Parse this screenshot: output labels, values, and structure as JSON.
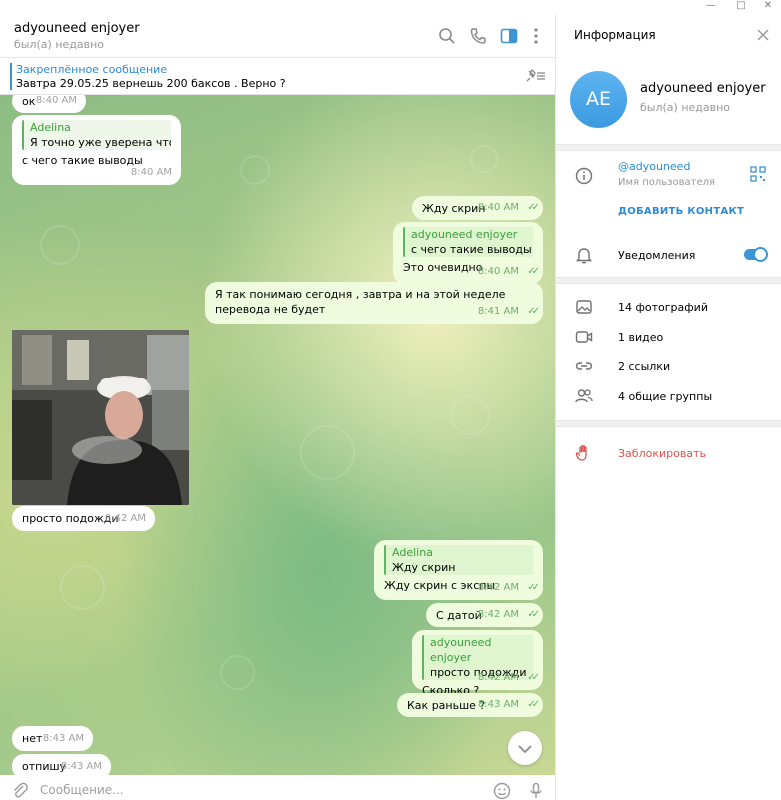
{
  "window": {
    "controls": [
      "minimize",
      "maximize",
      "close"
    ]
  },
  "chat": {
    "header": {
      "name": "adyouneed enjoyer",
      "status": "был(а) недавно"
    },
    "pinned": {
      "title": "Закреплённое сообщение",
      "text": "Завтра 29.05.25 вернешь 200 баксов . Верно ?"
    },
    "messages": [
      {
        "dir": "in",
        "text": "ок",
        "time": "8:40 AM"
      },
      {
        "dir": "in",
        "reply_name": "Adelina",
        "reply_text": "Я точно уже уверена что т...",
        "text": "с чего такие выводы",
        "time": "8:40 AM"
      },
      {
        "dir": "out",
        "text": "Жду скрин",
        "time": "8:40 AM"
      },
      {
        "dir": "out",
        "reply_name": "adyouneed enjoyer",
        "reply_text": "с чего такие выводы",
        "text": "Это очевидно",
        "time": "8:40 AM"
      },
      {
        "dir": "out",
        "text": "Я так понимаю сегодня , завтра и на этой неделе перевода не будет",
        "time": "8:41 AM"
      },
      {
        "dir": "in",
        "type": "photo"
      },
      {
        "dir": "in",
        "text": "просто подожди",
        "time": "8:42 AM"
      },
      {
        "dir": "out",
        "reply_name": "Adelina",
        "reply_text": "Жду скрин",
        "text": "Жду скрин с экспы",
        "time": "8:42 AM"
      },
      {
        "dir": "out",
        "text": "С датой",
        "time": "8:42 AM"
      },
      {
        "dir": "out",
        "reply_name": "adyouneed enjoyer",
        "reply_text": "просто подожди",
        "text": "Сколько ?",
        "time": "8:42 AM"
      },
      {
        "dir": "out",
        "text": "Как раньше ?",
        "time": "8:43 AM"
      },
      {
        "dir": "in",
        "text": "нет",
        "time": "8:43 AM"
      },
      {
        "dir": "in",
        "text": "отпишу",
        "time": "8:43 AM"
      }
    ],
    "compose": {
      "placeholder": "Сообщение..."
    }
  },
  "info": {
    "title": "Информация",
    "avatar_initials": "AE",
    "avatar_color": "#4aa6ea",
    "name": "adyouneed enjoyer",
    "status": "был(а) недавно",
    "username": "@adyouneed",
    "username_label": "Имя пользователя",
    "add_contact": "ДОБАВИТЬ КОНТАКТ",
    "notifications": "Уведомления",
    "notifications_on": true,
    "media": [
      {
        "icon": "photo-icon",
        "label": "14 фотографий"
      },
      {
        "icon": "video-icon",
        "label": "1 видео"
      },
      {
        "icon": "link-icon",
        "label": "2 ссылки"
      },
      {
        "icon": "groups-icon",
        "label": "4 общие группы"
      }
    ],
    "block": "Заблокировать"
  },
  "colors": {
    "accent": "#3a95d5",
    "outgoing": "#effdde",
    "danger": "#d9534f",
    "reply_name": "#3aa13a"
  }
}
